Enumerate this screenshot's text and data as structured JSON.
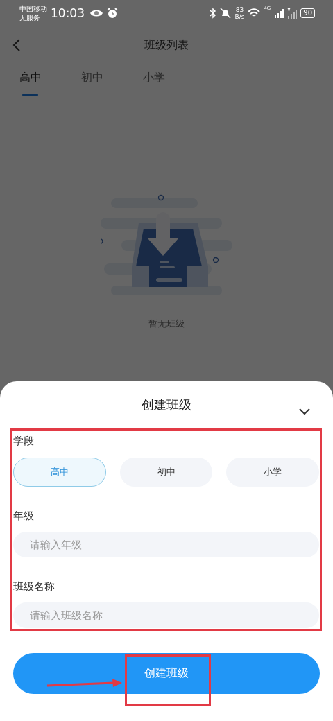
{
  "status_bar": {
    "carrier": "中国移动",
    "service": "无服务",
    "time": "10:03",
    "speed_value": "83",
    "speed_unit": "B/s",
    "network": "4G",
    "battery": "90"
  },
  "header": {
    "title": "班级列表"
  },
  "tabs": [
    {
      "label": "高中",
      "selected": true
    },
    {
      "label": "初中",
      "selected": false
    },
    {
      "label": "小学",
      "selected": false
    }
  ],
  "empty_state": {
    "message": "暂无班级"
  },
  "sheet": {
    "title": "创建班级",
    "stage_label": "学段",
    "stages": [
      {
        "label": "高中",
        "selected": true
      },
      {
        "label": "初中",
        "selected": false
      },
      {
        "label": "小学",
        "selected": false
      }
    ],
    "fields": [
      {
        "label": "年级",
        "placeholder": "请输入年级"
      },
      {
        "label": "班级名称",
        "placeholder": "请输入班级名称"
      }
    ],
    "submit": "创建班级"
  }
}
